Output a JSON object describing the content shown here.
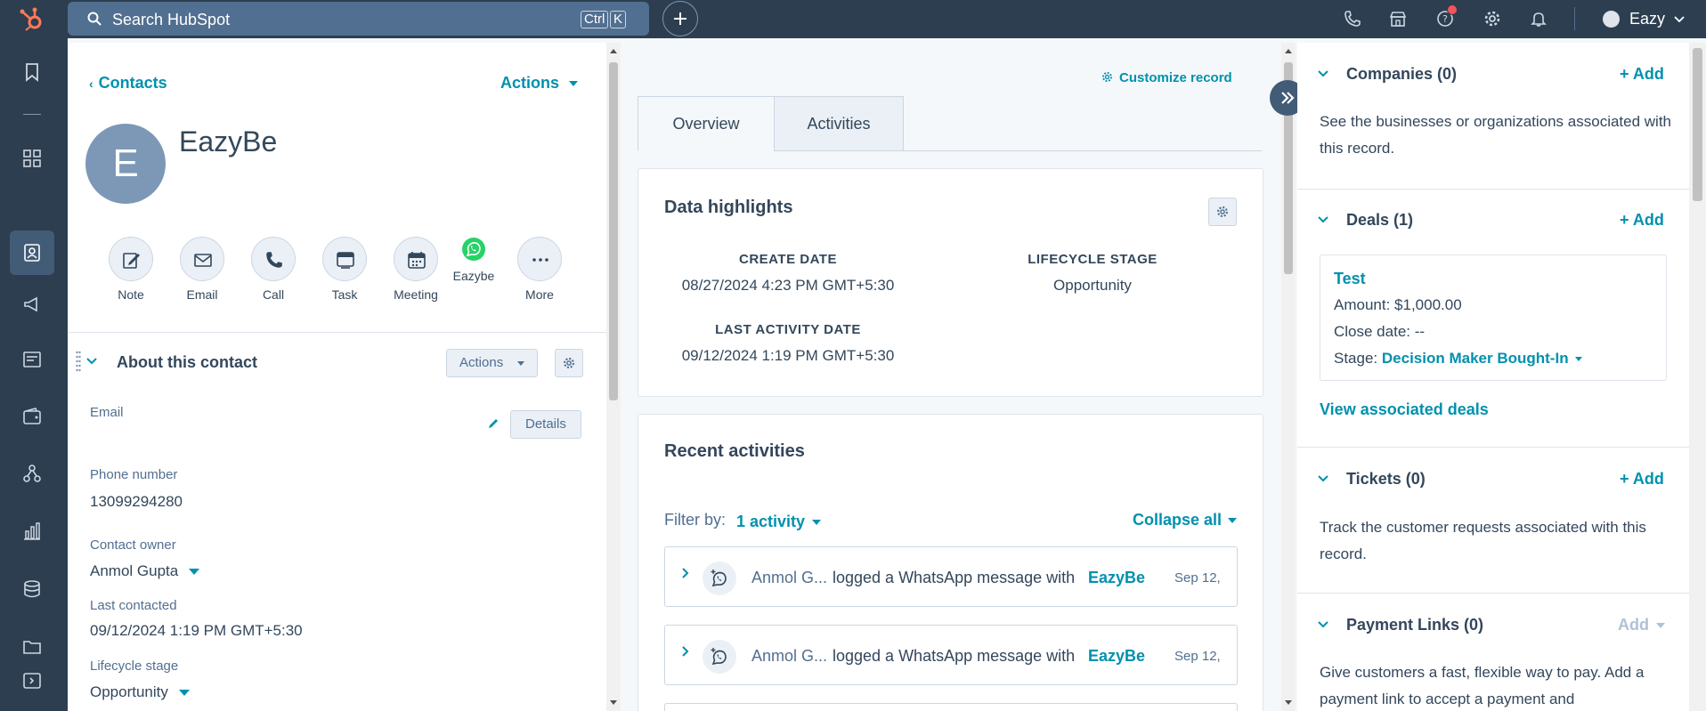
{
  "topbar": {
    "search_placeholder": "Search HubSpot",
    "kbd_ctrl": "Ctrl",
    "kbd_k": "K",
    "account_name": "Eazy"
  },
  "contact": {
    "back_label": "Contacts",
    "actions_label": "Actions",
    "avatar_initial": "E",
    "name": "EazyBe",
    "quick_actions": [
      "Note",
      "Email",
      "Call",
      "Task",
      "Meeting",
      "Eazybe",
      "More"
    ]
  },
  "about": {
    "title": "About this contact",
    "actions_label": "Actions",
    "details_label": "Details",
    "email_label": "Email",
    "phone_label": "Phone number",
    "phone_value": "13099294280",
    "owner_label": "Contact owner",
    "owner_value": "Anmol Gupta",
    "last_contacted_label": "Last contacted",
    "last_contacted_value": "09/12/2024 1:19 PM GMT+5:30",
    "lifecycle_label": "Lifecycle stage",
    "lifecycle_value": "Opportunity"
  },
  "middle": {
    "customize_label": "Customize record",
    "tabs": [
      "Overview",
      "Activities"
    ],
    "highlights_title": "Data highlights",
    "create_date_label": "CREATE DATE",
    "create_date_value": "08/27/2024 4:23 PM GMT+5:30",
    "lifecycle_label": "LIFECYCLE STAGE",
    "lifecycle_value": "Opportunity",
    "last_activity_label": "LAST ACTIVITY DATE",
    "last_activity_value": "09/12/2024 1:19 PM GMT+5:30",
    "recent_title": "Recent activities",
    "filter_label": "Filter by:",
    "filter_value": "1 activity",
    "collapse_label": "Collapse all",
    "activities": [
      {
        "who": "Anmol G...",
        "what": "logged a WhatsApp message with",
        "target": "EazyBe",
        "date": "Sep 12,"
      },
      {
        "who": "Anmol G...",
        "what": "logged a WhatsApp message with",
        "target": "EazyBe",
        "date": "Sep 12,"
      }
    ]
  },
  "sidebar": {
    "companies_title": "Companies (0)",
    "companies_desc": "See the businesses or organizations associated with this record.",
    "deals_title": "Deals (1)",
    "deal_name": "Test",
    "deal_amount": "Amount: $1,000.00",
    "deal_close": "Close date: --",
    "deal_stage_label": "Stage:",
    "deal_stage_value": "Decision Maker Bought-In",
    "view_deals": "View associated deals",
    "tickets_title": "Tickets (0)",
    "tickets_desc": "Track the customer requests associated with this record.",
    "payment_title": "Payment Links (0)",
    "payment_desc": "Give customers a fast, flexible way to pay. Add a payment link to accept a payment and",
    "add_label": "+ Add",
    "add_disabled_label": "Add"
  },
  "colors": {
    "nav": "#2d3e50",
    "link": "#0091ae",
    "brand": "#ff7a59"
  }
}
